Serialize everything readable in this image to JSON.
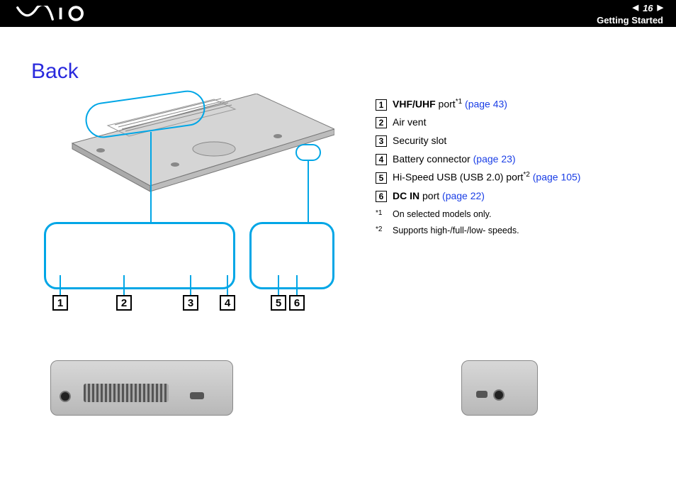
{
  "header": {
    "page_number": "16",
    "section": "Getting Started"
  },
  "title": "Back",
  "labels": {
    "l1": "1",
    "l2": "2",
    "l3": "3",
    "l4": "4",
    "l5": "5",
    "l6": "6"
  },
  "items": [
    {
      "num": "1",
      "bold": "VHF/UHF",
      "rest": " port",
      "sup": "*1",
      "link": "(page 43)"
    },
    {
      "num": "2",
      "bold": "",
      "rest": "Air vent",
      "sup": "",
      "link": ""
    },
    {
      "num": "3",
      "bold": "",
      "rest": "Security slot",
      "sup": "",
      "link": ""
    },
    {
      "num": "4",
      "bold": "",
      "rest": "Battery connector ",
      "sup": "",
      "link": "(page 23)"
    },
    {
      "num": "5",
      "bold": "",
      "rest": "Hi-Speed USB (USB 2.0) port",
      "sup": "*2",
      "link": "(page 105)"
    },
    {
      "num": "6",
      "bold": "DC IN",
      "rest": " port ",
      "sup": "",
      "link": "(page 22)"
    }
  ],
  "footnotes": [
    {
      "mark": "*1",
      "text": "On selected models only."
    },
    {
      "mark": "*2",
      "text": "Supports high-/full-/low- speeds."
    }
  ]
}
